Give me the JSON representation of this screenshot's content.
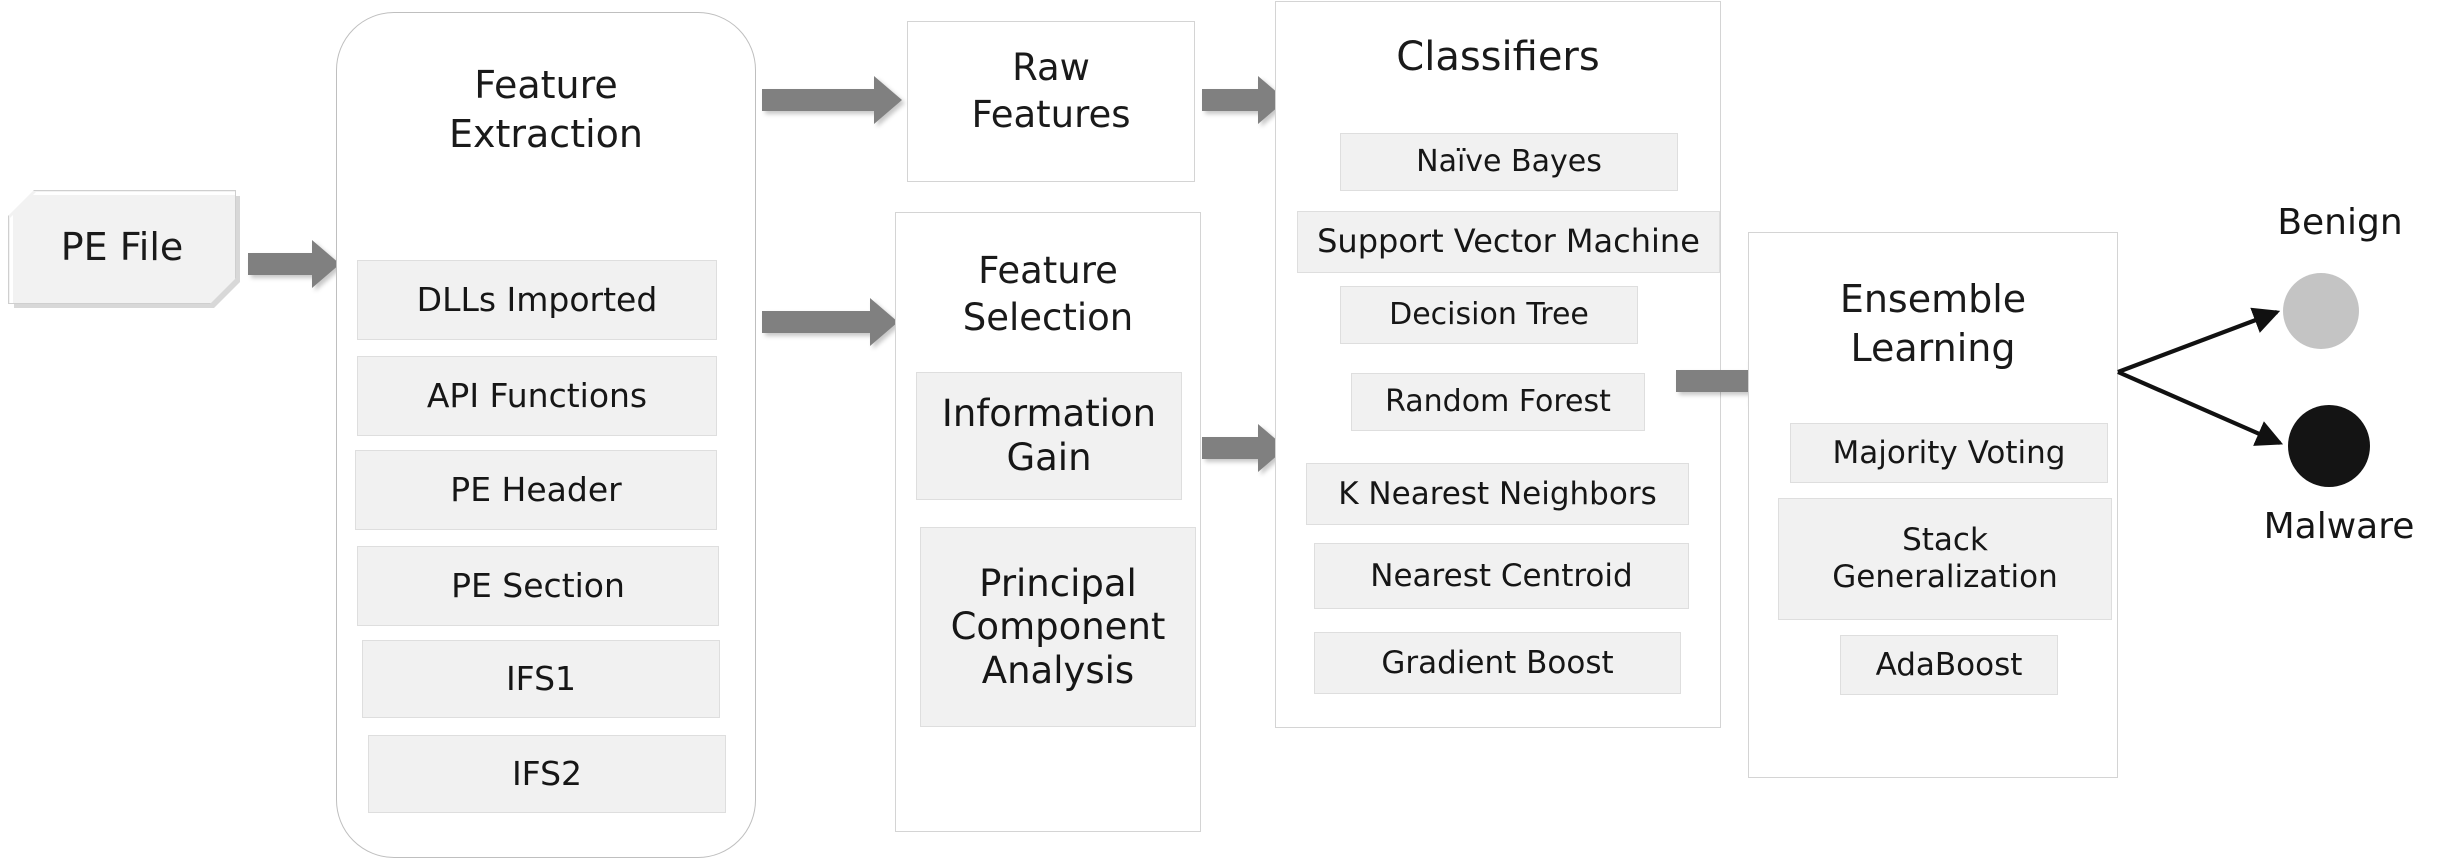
{
  "diagram": {
    "title": "PE malware detection pipeline",
    "colors": {
      "arrow_gray": "#808080",
      "chip_fill": "#f1f1f1",
      "chip_border": "#dedede",
      "box_border": "#d4d4d4",
      "rounded_box_border": "#bfbfbf",
      "benign_circle": "#c4c4c4",
      "malware_circle": "#141414",
      "text": "#161616"
    }
  },
  "input": {
    "label": "PE File",
    "shape": "beveled-document"
  },
  "feature_extraction": {
    "title_line1": "Feature",
    "title_line2": "Extraction",
    "items": [
      {
        "label": "DLLs Imported"
      },
      {
        "label": "API Functions"
      },
      {
        "label": "PE Header"
      },
      {
        "label": "PE Section"
      },
      {
        "label": "IFS1"
      },
      {
        "label": "IFS2"
      }
    ]
  },
  "raw_features": {
    "title_line1": "Raw",
    "title_line2": "Features"
  },
  "feature_selection": {
    "title_line1": "Feature",
    "title_line2": "Selection",
    "items": [
      {
        "label": "Information Gain"
      },
      {
        "label": "Principal Component Analysis"
      }
    ]
  },
  "classifiers": {
    "title": "Classifiers",
    "items": [
      {
        "label": "Naïve Bayes"
      },
      {
        "label": "Support Vector Machine"
      },
      {
        "label": "Decision Tree"
      },
      {
        "label": "Random Forest"
      },
      {
        "label": "K Nearest Neighbors"
      },
      {
        "label": "Nearest Centroid"
      },
      {
        "label": "Gradient Boost"
      }
    ]
  },
  "ensemble": {
    "title_line1": "Ensemble",
    "title_line2": "Learning",
    "items": [
      {
        "label": "Majority Voting"
      },
      {
        "label": "Stack Generalization"
      },
      {
        "label": "AdaBoost"
      }
    ]
  },
  "outputs": [
    {
      "label": "Benign",
      "color": "#c4c4c4"
    },
    {
      "label": "Malware",
      "color": "#141414"
    }
  ],
  "arrows": [
    {
      "from": "PE File",
      "to": "Feature Extraction"
    },
    {
      "from": "Feature Extraction",
      "to": "Raw Features"
    },
    {
      "from": "Feature Extraction",
      "to": "Feature Selection"
    },
    {
      "from": "Raw Features",
      "to": "Classifiers"
    },
    {
      "from": "Feature Selection",
      "to": "Classifiers"
    },
    {
      "from": "Classifiers",
      "to": "Ensemble Learning"
    },
    {
      "from": "Ensemble Learning",
      "to": "Benign"
    },
    {
      "from": "Ensemble Learning",
      "to": "Malware"
    }
  ]
}
